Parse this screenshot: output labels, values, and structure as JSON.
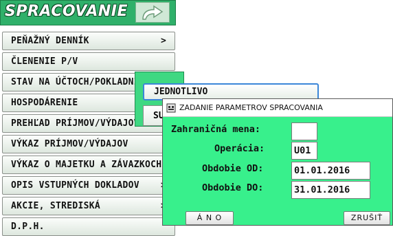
{
  "header": {
    "title": "SPRACOVANIE",
    "icon": "arrow-right-icon"
  },
  "menu": [
    {
      "label": "PEŇAŽNÝ DENNÍK",
      "arrow": ">"
    },
    {
      "label": "ČLENENIE P/V",
      "arrow": ""
    },
    {
      "label": "STAV NA ÚČTOCH/POKLADNICIACH",
      "arrow": ""
    },
    {
      "label": "HOSPODÁRENIE",
      "arrow": ""
    },
    {
      "label": "PREHĽAD PRÍJMOV/VÝDAJOV",
      "arrow": ""
    },
    {
      "label": "VÝKAZ PRÍJMOV/VÝDAJOV",
      "arrow": ""
    },
    {
      "label": "VÝKAZ O MAJETKU A ZÁVAZKOCH",
      "arrow": ""
    },
    {
      "label": "OPIS VSTUPNÝCH DOKLADOV",
      "arrow": ">"
    },
    {
      "label": "AKCIE, STREDISKÁ",
      "arrow": ">"
    },
    {
      "label": "D.P.H.",
      "arrow": ""
    }
  ],
  "submenu": {
    "item1": "JEDNOTLIVO",
    "item2": "SU"
  },
  "dialog": {
    "title": "ZADANIE PARAMETROV SPRACOVANIA",
    "fields": {
      "currency_label": "Zahraničná mena:",
      "currency_value": "",
      "operation_label": "Operácia:",
      "operation_value": "U01",
      "from_label": "Obdobie OD:",
      "from_value": "01.01.2016",
      "to_label": "Obdobie DO:",
      "to_value": "31.01.2016"
    },
    "ok_label": "Á N O",
    "cancel_label": "ZRUŠIŤ"
  },
  "colors": {
    "dialog_bg": "#38f08c",
    "header_bg": "#2fb06a",
    "submenu_bg": "#3fd882"
  }
}
